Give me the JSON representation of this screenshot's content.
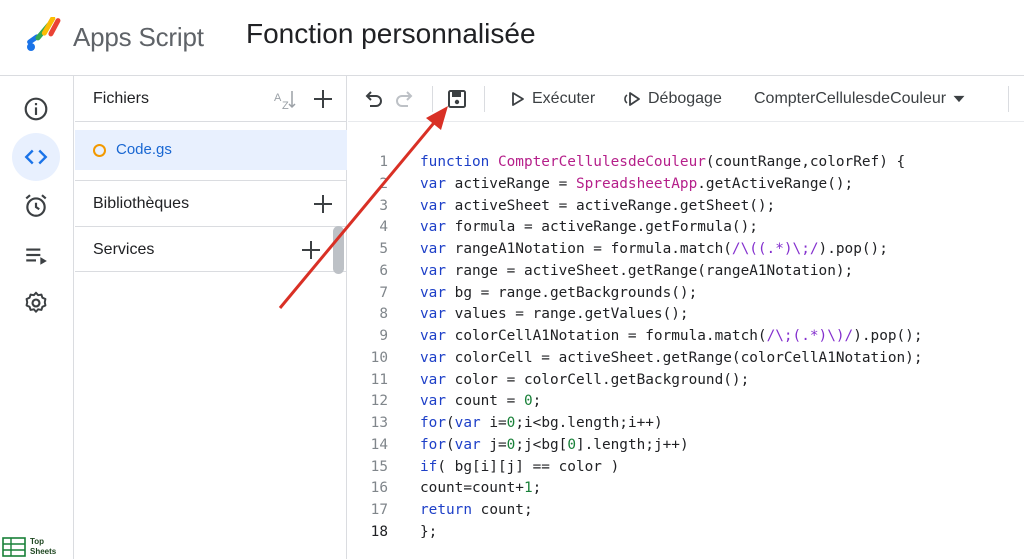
{
  "header": {
    "app_name": "Apps Script",
    "project_title": "Fonction personnalisée"
  },
  "rail": {
    "items": [
      {
        "icon": "info-icon",
        "label": "Présentation"
      },
      {
        "icon": "code-icon",
        "label": "Éditeur",
        "active": true
      },
      {
        "icon": "alarm-icon",
        "label": "Déclencheurs"
      },
      {
        "icon": "executions-icon",
        "label": "Exécutions"
      },
      {
        "icon": "gear-icon",
        "label": "Paramètres"
      }
    ],
    "brand": "Top\nSheets"
  },
  "files_panel": {
    "title": "Fichiers",
    "files": [
      {
        "name": "Code.gs",
        "selected": true
      }
    ],
    "sections": [
      {
        "label": "Bibliothèques"
      },
      {
        "label": "Services"
      }
    ]
  },
  "toolbar": {
    "run_label": "Exécuter",
    "debug_label": "Débogage",
    "function_select": "CompterCellulesdeCouleur"
  },
  "editor": {
    "current_line": 18,
    "lines": [
      [
        [
          "kw",
          "function "
        ],
        [
          "fn",
          "CompterCellulesdeCouleur"
        ],
        [
          "p",
          "(countRange,colorRef) {"
        ]
      ],
      [
        [
          "kw",
          "var "
        ],
        [
          "p",
          "activeRange = "
        ],
        [
          "fn",
          "SpreadsheetApp"
        ],
        [
          "p",
          ".getActiveRange();"
        ]
      ],
      [
        [
          "kw",
          "var "
        ],
        [
          "p",
          "activeSheet = activeRange.getSheet();"
        ]
      ],
      [
        [
          "kw",
          "var "
        ],
        [
          "p",
          "formula = activeRange.getFormula();"
        ]
      ],
      [
        [
          "kw",
          "var "
        ],
        [
          "p",
          "rangeA1Notation = formula.match("
        ],
        [
          "re",
          "/\\((.*)\\;/"
        ],
        [
          "p",
          ").pop();"
        ]
      ],
      [
        [
          "kw",
          "var "
        ],
        [
          "p",
          "range = activeSheet.getRange(rangeA1Notation);"
        ]
      ],
      [
        [
          "kw",
          "var "
        ],
        [
          "p",
          "bg = range.getBackgrounds();"
        ]
      ],
      [
        [
          "kw",
          "var "
        ],
        [
          "p",
          "values = range.getValues();"
        ]
      ],
      [
        [
          "kw",
          "var "
        ],
        [
          "p",
          "colorCellA1Notation = formula.match("
        ],
        [
          "re",
          "/\\;(.*)\\)/"
        ],
        [
          "p",
          ").pop();"
        ]
      ],
      [
        [
          "kw",
          "var "
        ],
        [
          "p",
          "colorCell = activeSheet.getRange(colorCellA1Notation);"
        ]
      ],
      [
        [
          "kw",
          "var "
        ],
        [
          "p",
          "color = colorCell.getBackground();"
        ]
      ],
      [
        [
          "kw",
          "var "
        ],
        [
          "p",
          "count = "
        ],
        [
          "num",
          "0"
        ],
        [
          "p",
          ";"
        ]
      ],
      [
        [
          "kw",
          "for"
        ],
        [
          "p",
          "("
        ],
        [
          "kw",
          "var "
        ],
        [
          "p",
          "i="
        ],
        [
          "num",
          "0"
        ],
        [
          "p",
          ";i<bg.length;i++)"
        ]
      ],
      [
        [
          "kw",
          "for"
        ],
        [
          "p",
          "("
        ],
        [
          "kw",
          "var "
        ],
        [
          "p",
          "j="
        ],
        [
          "num",
          "0"
        ],
        [
          "p",
          ";j<bg["
        ],
        [
          "num",
          "0"
        ],
        [
          "p",
          "].length;j++)"
        ]
      ],
      [
        [
          "kw",
          "if"
        ],
        [
          "p",
          "( bg[i][j] == color )"
        ]
      ],
      [
        [
          "p",
          "count=count+"
        ],
        [
          "num",
          "1"
        ],
        [
          "p",
          ";"
        ]
      ],
      [
        [
          "kw",
          "return "
        ],
        [
          "p",
          "count;"
        ]
      ],
      [
        [
          "p",
          "};"
        ]
      ]
    ]
  },
  "colors": {
    "accent": "#1a73e8",
    "selected_bg": "#e8f0fe",
    "arrow": "#d93025",
    "keyword": "#1e40c8",
    "function": "#b51f8a",
    "number": "#188038"
  }
}
